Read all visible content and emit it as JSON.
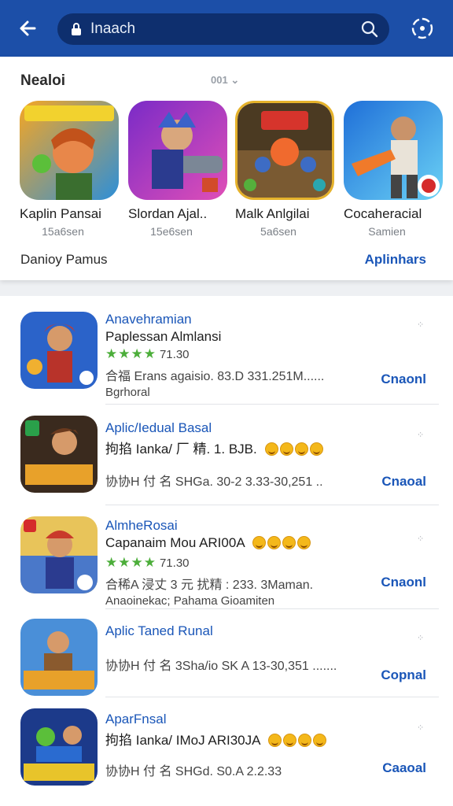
{
  "header": {
    "search_value": "Inaach",
    "colors": {
      "bar": "#1c4fa8",
      "search_bg": "#0e2f6e"
    }
  },
  "featured": {
    "title": "Nealoi",
    "toggle_label": "001",
    "items": [
      {
        "title": "Kaplin Pansai",
        "subtitle": "15a6sen"
      },
      {
        "title": "Slordan Ajal..",
        "subtitle": "15e6sen"
      },
      {
        "title": "Malk Anlgilai",
        "subtitle": "5a6sen"
      },
      {
        "title": "Cocaheracial",
        "subtitle": "Samien"
      }
    ],
    "footer_left": "Danioy Pamus",
    "footer_right": "Aplinhars"
  },
  "list": {
    "rows": [
      {
        "category": "Anavehramian",
        "title": "Paplessan Almlansi",
        "rating": "71.30",
        "meta": "合福 Erans agaisio. 83.D 331.251M......",
        "developer": "Bgrhoral",
        "action": "Cnaonl"
      },
      {
        "category": "Aplic/Iedual Basal",
        "title": "拘掐 Ianka/ 厂 精. 1. BJB.",
        "meta": "协协H 付 名 SHGa. 30-2 3.33-30,251 ..",
        "action": "Cnaoal"
      },
      {
        "category": "AlmheRosai",
        "title": "Capanaim Mou ARI00A",
        "rating": "71.30",
        "meta": "合稀A 浸丈 3 元 扰精 : 233. 3Maman.",
        "developer": "Anaoinekac; Pahama Gioamiten",
        "action": "Cnaonl"
      },
      {
        "category": "Aplic Taned Runal",
        "meta": "协协H 付 名 3Sha/io SK A 13-30,351 .......",
        "action": "Copnal"
      },
      {
        "category": "AparFnsal",
        "title": "拘掐 Ianka/ IMoJ ARI30JA",
        "meta": "协协H 付 名 SHGd. S0.A 2.2.33",
        "action": "Caaoal"
      }
    ]
  },
  "colors": {
    "accent": "#1a56b8",
    "star": "#4cae3a"
  }
}
